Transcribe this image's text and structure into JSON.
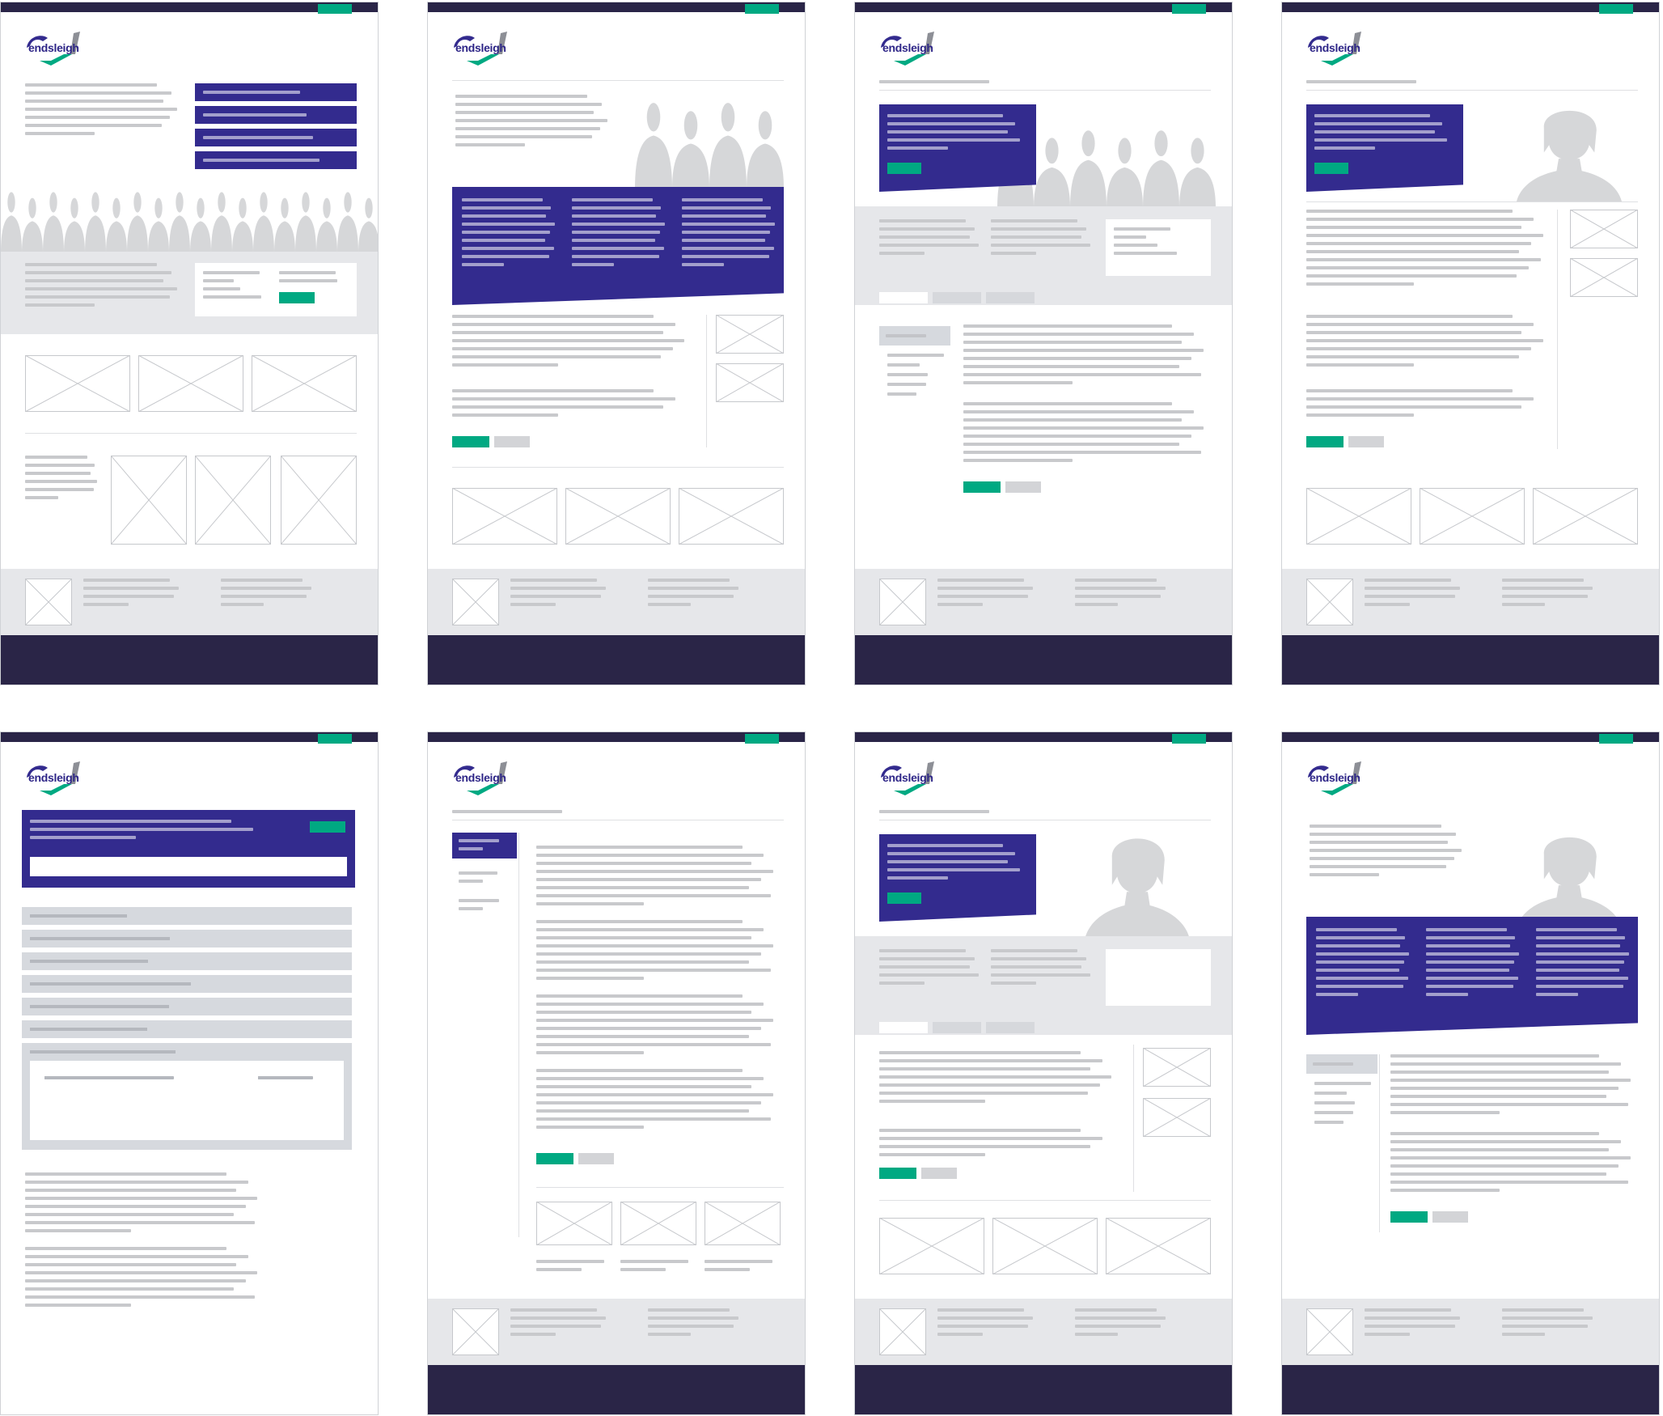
{
  "brand": {
    "logo_text": "endsleigh",
    "colors": {
      "primary_purple": "#332b8e",
      "navy": "#2a2547",
      "accent_green": "#00a982",
      "light_grey": "#e6e7ea",
      "placeholder_grey": "#c8c9cc"
    }
  },
  "icons": {
    "image_placeholder": "crossed-box-icon",
    "people_group": "group-silhouette",
    "person_single": "woman-silhouette"
  },
  "wireframes": [
    {
      "id": "homepage",
      "layout": "hero-crowd-with-link-list"
    },
    {
      "id": "landing-group",
      "layout": "purple-three-column-panel"
    },
    {
      "id": "content-with-group-hero",
      "layout": "hero-group-with-sidebar-nav"
    },
    {
      "id": "article-with-person",
      "layout": "person-hero-with-right-thumbnails"
    },
    {
      "id": "faq-accordion",
      "layout": "search-and-accordion"
    },
    {
      "id": "long-article-left-nav",
      "layout": "left-nav-long-text"
    },
    {
      "id": "person-hero-tabs",
      "layout": "person-hero-tabs-sidebar"
    },
    {
      "id": "person-three-column",
      "layout": "person-three-column-panel"
    }
  ]
}
